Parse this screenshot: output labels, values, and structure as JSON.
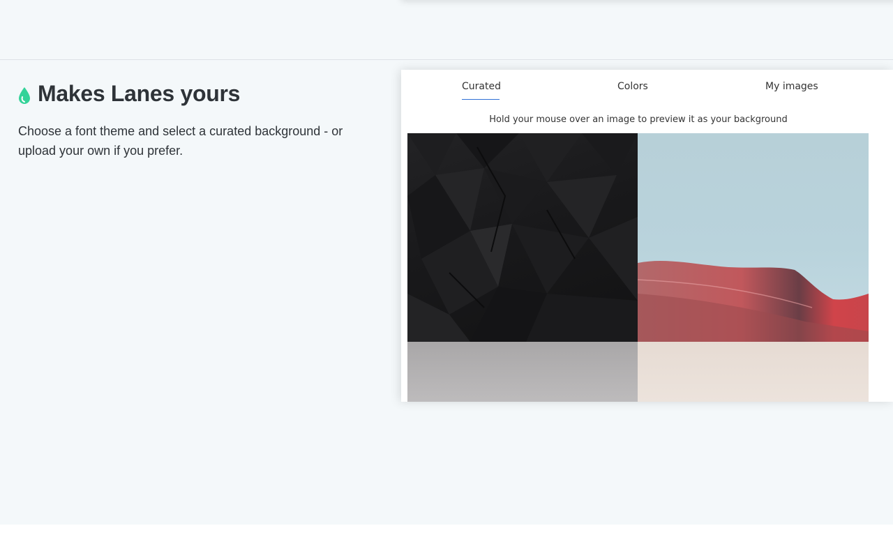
{
  "feature": {
    "title": "Makes Lanes yours",
    "description": "Choose a font theme and select a curated background - or upload your own if you prefer.",
    "icon": "drop-icon",
    "accent_color": "#34d399"
  },
  "preview": {
    "tabs": [
      {
        "label": "Curated",
        "active": true
      },
      {
        "label": "Colors",
        "active": false
      },
      {
        "label": "My images",
        "active": false
      }
    ],
    "hint": "Hold your mouse over an image to preview it as your background",
    "images": [
      {
        "name": "dark-polygon-background"
      },
      {
        "name": "red-dune-background"
      },
      {
        "name": "grey-texture-background"
      },
      {
        "name": "beige-sand-background"
      }
    ]
  }
}
